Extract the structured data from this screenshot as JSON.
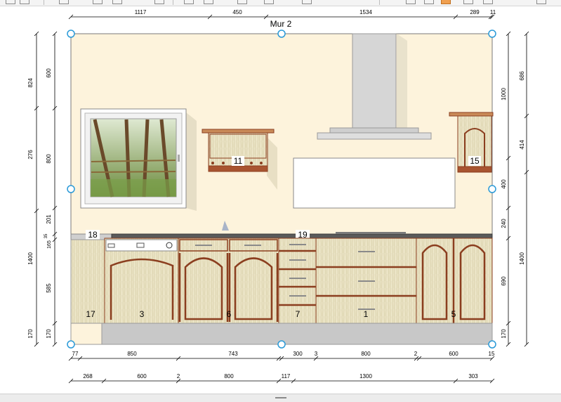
{
  "wall": {
    "title": "Mur 2"
  },
  "dimensions": {
    "top": [
      "1117",
      "450",
      "1534",
      "289",
      "11"
    ],
    "bottom_row1": [
      "77",
      "850",
      "743",
      "300",
      "3",
      "800",
      "2",
      "600",
      "15"
    ],
    "bottom_row2": [
      "268",
      "600",
      "2",
      "800",
      "117",
      "1300",
      "303"
    ],
    "left_outer": [
      "824",
      "276",
      "1400",
      "170"
    ],
    "left_inner": [
      "600",
      "800",
      "201",
      "35",
      "165",
      "585",
      "170"
    ],
    "right_inner": [
      "1000",
      "400",
      "240",
      "690",
      "170"
    ],
    "right_outer": [
      "686",
      "414",
      "1400"
    ]
  },
  "labels": {
    "wall_cabinet_11": "11",
    "wall_cabinet_15": "15",
    "worktop_18": "18",
    "worktop_19": "19",
    "side_panel_17": "17",
    "dishwasher_3": "3",
    "base_cabinet_6": "6",
    "drawer_unit_7": "7",
    "base_cabinet_1": "1",
    "tall_cabinet_5": "5"
  },
  "colors": {
    "wall_fill": "#fdf3dc",
    "cabinet_wood": "#e9e3c4",
    "cabinet_trim": "#8b3e1f",
    "countertop": "#5a5a5a",
    "plinth": "#c8c8c8",
    "handle_point": "#2a9ad8",
    "hood": "#d6d6d6",
    "toolbar_active": "#f0a050"
  },
  "toolbar": {
    "icons": [
      "arrow-left-icon",
      "arrow-right-icon",
      "ruler-icon",
      "align-icon",
      "circle-icon",
      "grid-icon",
      "bracket-icon",
      "rotate-icon",
      "chevron-icon",
      "line-icon",
      "wall-view-icon",
      "elevation-icon",
      "active-view-icon",
      "plan-icon",
      "export-icon",
      "more-icon"
    ]
  }
}
